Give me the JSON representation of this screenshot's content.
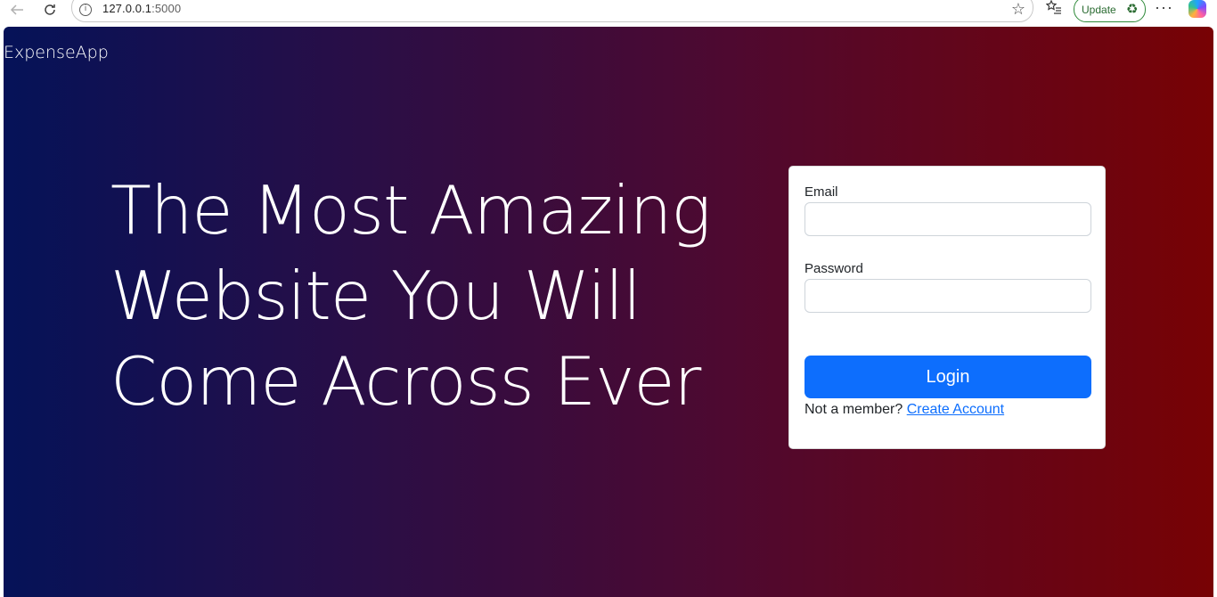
{
  "browser": {
    "back_icon": "arrow-left-icon",
    "reload_icon": "reload-icon",
    "url_host": "127.0.0.1",
    "url_port": ":5000",
    "update_label": "Update"
  },
  "app": {
    "brand": "ExpenseApp"
  },
  "hero": {
    "line1": "The Most Amazing",
    "line2": "Website You Will",
    "line3": "Come Across Ever"
  },
  "login_form": {
    "email_label": "Email",
    "email_value": "",
    "password_label": "Password",
    "password_value": "",
    "login_button": "Login",
    "member_prompt": "Not a member?",
    "create_account_link": "Create Account"
  },
  "colors": {
    "gradient_left": "#051258",
    "gradient_right": "#780204",
    "primary_button": "#0d6efd",
    "link": "#0d6efd"
  }
}
